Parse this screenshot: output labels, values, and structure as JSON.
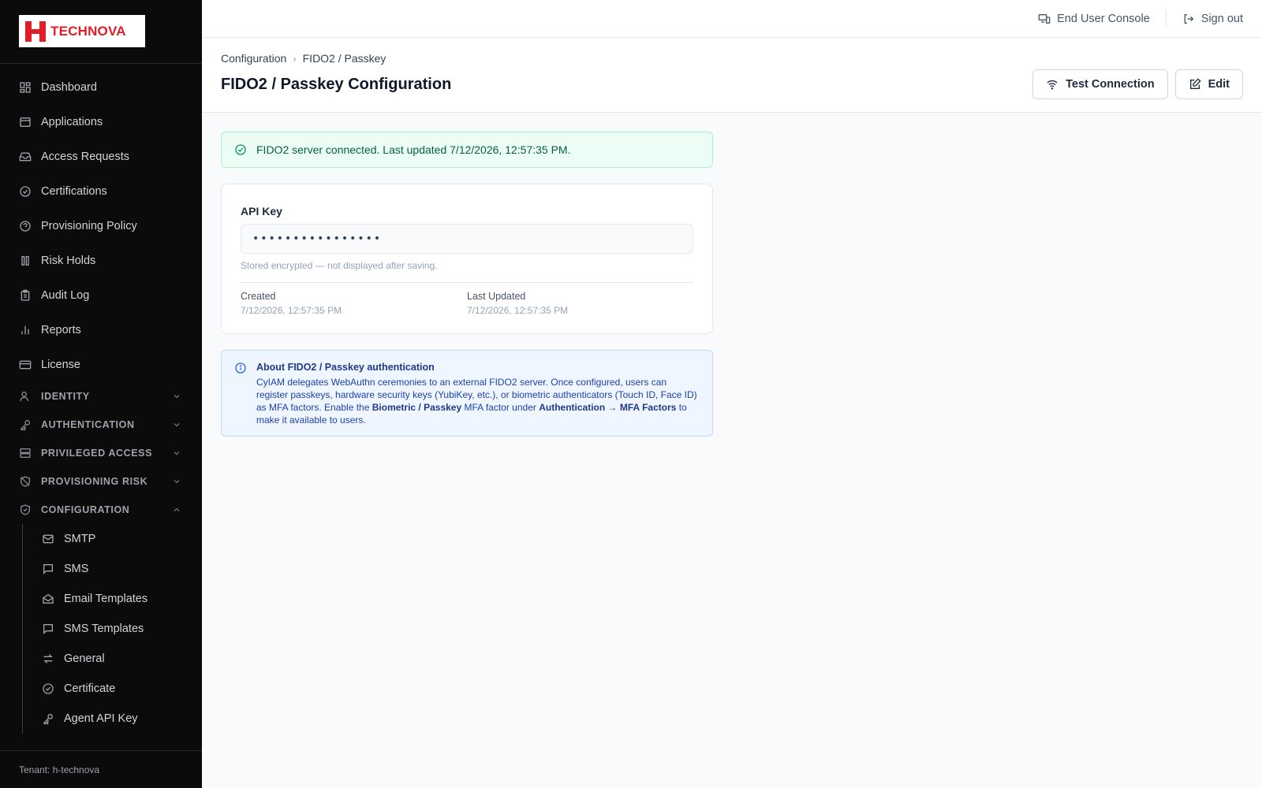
{
  "brand": {
    "name": "TECHNOVA",
    "color": "#e11d2a"
  },
  "sidebar": {
    "items": [
      {
        "label": "Dashboard",
        "icon": "dashboard-icon"
      },
      {
        "label": "Applications",
        "icon": "window-icon"
      },
      {
        "label": "Access Requests",
        "icon": "inbox-icon"
      },
      {
        "label": "Certifications",
        "icon": "check-circle-icon"
      },
      {
        "label": "Provisioning Policy",
        "icon": "policy-icon"
      },
      {
        "label": "Risk Holds",
        "icon": "pause-icon"
      },
      {
        "label": "Audit Log",
        "icon": "clipboard-icon"
      },
      {
        "label": "Reports",
        "icon": "bar-chart-icon"
      },
      {
        "label": "License",
        "icon": "card-icon"
      }
    ],
    "groups": [
      {
        "label": "IDENTITY",
        "icon": "user-icon",
        "expanded": false
      },
      {
        "label": "AUTHENTICATION",
        "icon": "key-icon",
        "expanded": false
      },
      {
        "label": "PRIVILEGED ACCESS",
        "icon": "server-icon",
        "expanded": false
      },
      {
        "label": "PROVISIONING RISK",
        "icon": "shield-off-icon",
        "expanded": false
      },
      {
        "label": "CONFIGURATION",
        "icon": "shield-check-icon",
        "expanded": true
      }
    ],
    "config_items": [
      {
        "label": "SMTP",
        "icon": "mail-icon"
      },
      {
        "label": "SMS",
        "icon": "message-icon"
      },
      {
        "label": "Email Templates",
        "icon": "mail-open-icon"
      },
      {
        "label": "SMS Templates",
        "icon": "message-icon"
      },
      {
        "label": "General",
        "icon": "arrows-icon"
      },
      {
        "label": "Certificate",
        "icon": "check-circle-icon"
      },
      {
        "label": "Agent API Key",
        "icon": "key-icon"
      }
    ],
    "tenant": "Tenant: h-technova"
  },
  "topbar": {
    "end_user_console": "End User Console",
    "sign_out": "Sign out"
  },
  "header": {
    "breadcrumb": [
      "Configuration",
      "FIDO2 / Passkey"
    ],
    "title": "FIDO2 / Passkey Configuration",
    "test_connection": "Test Connection",
    "edit": "Edit"
  },
  "status_alert": {
    "text": "FIDO2 server connected. Last updated 7/12/2026, 12:57:35 PM.",
    "color": "#059669"
  },
  "card": {
    "api_key_label": "API Key",
    "api_key_value": "••••••••••••••••",
    "api_key_hint": "Stored encrypted — not displayed after saving.",
    "created_label": "Created",
    "created_value": "7/12/2026, 12:57:35 PM",
    "updated_label": "Last Updated",
    "updated_value": "7/12/2026, 12:57:35 PM"
  },
  "info": {
    "title": "About FIDO2 / Passkey authentication",
    "text_1": "CyIAM delegates WebAuthn ceremonies to an external FIDO2 server. Once configured, users can register passkeys, hardware security keys (YubiKey, etc.), or biometric authenticators (Touch ID, Face ID) as MFA factors. Enable the ",
    "bold_1": "Biometric / Passkey",
    "text_2": " MFA factor under ",
    "bold_2": "Authentication → MFA Factors",
    "text_3": " to make it available to users."
  }
}
